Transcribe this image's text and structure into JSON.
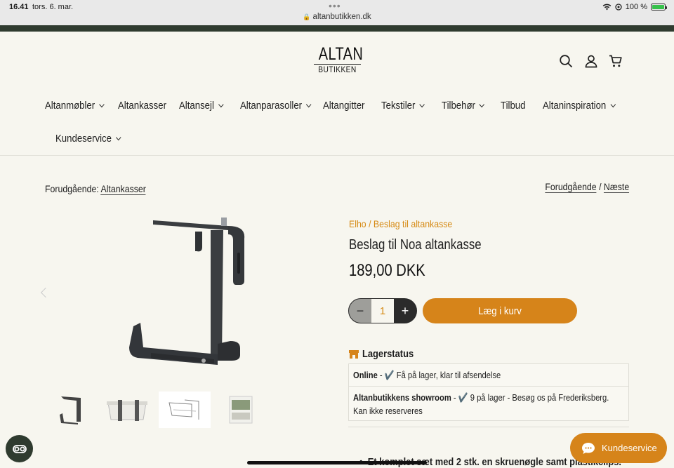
{
  "status_bar": {
    "time": "16.41",
    "date": "tors. 6. mar.",
    "url": "altanbutikken.dk",
    "battery": "100 %",
    "battery_level": 1.0
  },
  "header": {
    "logo_main": "ALTAN",
    "logo_sub": "BUTIKKEN",
    "icons": [
      "search-icon",
      "account-icon",
      "cart-icon"
    ]
  },
  "nav": {
    "items": [
      {
        "label": "Altanmøbler",
        "dropdown": true
      },
      {
        "label": "Altankasser",
        "dropdown": false
      },
      {
        "label": "Altansejl",
        "dropdown": true
      },
      {
        "label": "Altanparasoller",
        "dropdown": true
      },
      {
        "label": "Altangitter",
        "dropdown": false
      },
      {
        "label": "Tekstiler",
        "dropdown": true
      },
      {
        "label": "Tilbehør",
        "dropdown": true
      },
      {
        "label": "Tilbud",
        "dropdown": false
      },
      {
        "label": "Altaninspiration",
        "dropdown": true
      },
      {
        "label": "Kundeservice",
        "dropdown": true
      }
    ]
  },
  "breadcrumb": {
    "prefix": "Forudgående:",
    "link": "Altankasser"
  },
  "pager": {
    "prev": "Forudgående",
    "sep": "/",
    "next": "Næste"
  },
  "product": {
    "vendor_line": "Elho / Beslag til altankasse",
    "title": "Beslag til Noa altankasse",
    "price": "189,00 DKK",
    "quantity": "1",
    "minus": "−",
    "plus": "+",
    "add_to_cart": "Læg i kurv"
  },
  "stock": {
    "heading": "Lagerstatus",
    "rows": [
      {
        "location": "Online",
        "text": " - ✔️ Få på lager, klar til afsendelse"
      },
      {
        "location": "Altanbutikkens showroom",
        "text": " - ✔️ 9 på lager - Besøg os på Frederiksberg. Kan ikke reserveres"
      }
    ]
  },
  "description": {
    "bullet": "Et komplet sæt med 2 stk. en skruenøgle samt plastikclips."
  },
  "chat": {
    "label": "Kundeservice"
  },
  "colors": {
    "accent": "#d6841a",
    "dark_green": "#2f3b2f",
    "background": "#f7f6ef"
  }
}
